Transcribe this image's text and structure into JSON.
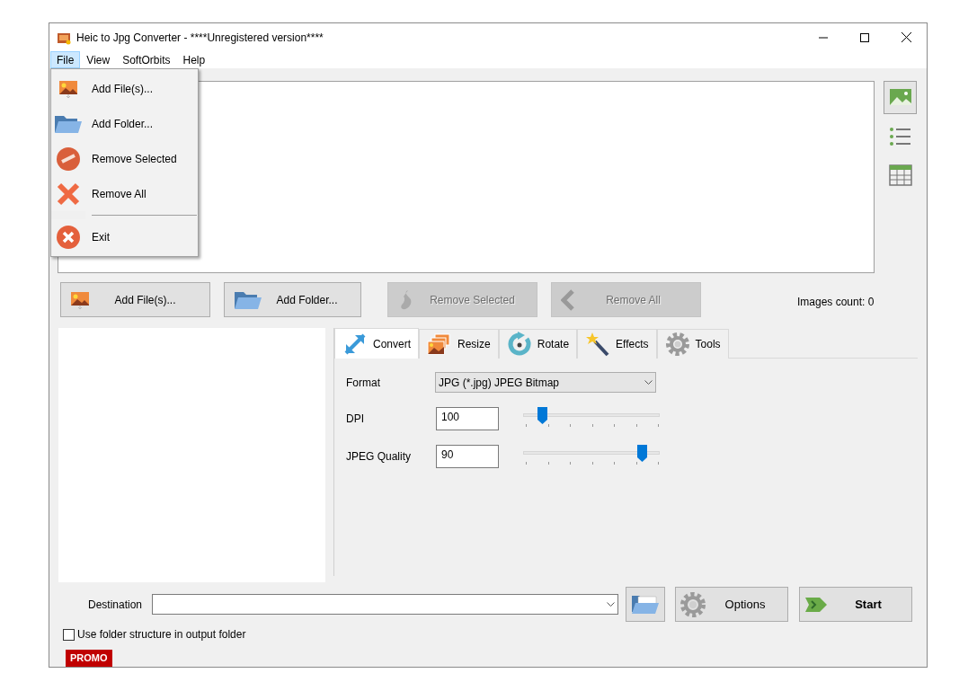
{
  "window": {
    "title": "Heic to Jpg Converter - ****Unregistered version****"
  },
  "menu": [
    {
      "label": "File",
      "selected": true
    },
    {
      "label": "View",
      "selected": false
    },
    {
      "label": "SoftOrbits",
      "selected": false
    },
    {
      "label": "Help",
      "selected": false
    }
  ],
  "file_menu": [
    {
      "kind": "item",
      "label": "Add File(s)..."
    },
    {
      "kind": "item",
      "label": "Add Folder..."
    },
    {
      "kind": "item",
      "label": "Remove Selected"
    },
    {
      "kind": "item",
      "label": "Remove All"
    },
    {
      "kind": "separator"
    },
    {
      "kind": "item",
      "label": "Exit"
    }
  ],
  "views": [
    {
      "selected": true
    },
    {
      "selected": false
    },
    {
      "selected": false
    }
  ],
  "buttons": [
    {
      "label": "Add File(s)...",
      "disabled": false
    },
    {
      "label": "Add Folder...",
      "disabled": false
    },
    {
      "label": "Remove Selected",
      "disabled": true
    },
    {
      "label": "Remove All",
      "disabled": true
    }
  ],
  "images_count": "Images count: 0",
  "tabs": [
    {
      "label": "Convert",
      "selected": true
    },
    {
      "label": "Resize",
      "selected": false
    },
    {
      "label": "Rotate",
      "selected": false
    },
    {
      "label": "Effects",
      "selected": false
    },
    {
      "label": "Tools",
      "selected": false
    }
  ],
  "format": {
    "label": "Format",
    "value": "JPG (*.jpg) JPEG Bitmap"
  },
  "sliders": [
    {
      "label": "DPI",
      "value": "100",
      "level": 0.14
    },
    {
      "label": "JPEG Quality",
      "value": "90",
      "level": 0.87
    }
  ],
  "destination": {
    "label": "Destination"
  },
  "options_button": "Options",
  "start_button": "Start",
  "folder_structure": {
    "label": "Use folder structure in output folder",
    "checked": false
  },
  "promo": "PROMO"
}
